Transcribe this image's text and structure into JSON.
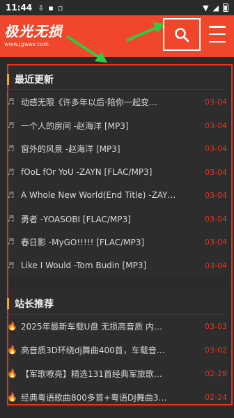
{
  "status": {
    "time": "11:44"
  },
  "header": {
    "logo_text": "极光无损",
    "logo_sub": "www.jgwav.com",
    "accent": "#f0472c"
  },
  "sections": {
    "recent": {
      "title": "最近更新",
      "items": [
        {
          "title": "动感无限《许多年以后·陪你一起变…",
          "date": "03-04"
        },
        {
          "title": "一个人的房间 -赵海洋 [MP3]",
          "date": "03-04"
        },
        {
          "title": "窗外的风景 -赵海洋 [MP3]",
          "date": "03-04"
        },
        {
          "title": "fOoL fOr YoU -ZAYN [FLAC/MP3]",
          "date": "03-04"
        },
        {
          "title": "A Whole New World(End Title) -ZAY…",
          "date": "03-04"
        },
        {
          "title": "勇者 -YOASOBI [FLAC/MP3]",
          "date": "03-04"
        },
        {
          "title": "春日影 -MyGO!!!!! [FLAC/MP3]",
          "date": "03-04"
        },
        {
          "title": "Like I Would -Tom Budin [MP3]",
          "date": "03-04"
        }
      ]
    },
    "recommend": {
      "title": "站长推荐",
      "items": [
        {
          "title": "2025年最新车载U盘 无损高音质 内…",
          "date": "03-03"
        },
        {
          "title": "高音质3D环绕dj舞曲400首，车载音…",
          "date": "03-02"
        },
        {
          "title": "【军歌嘹亮】精选131首经典军旅歌…",
          "date": "02-28"
        },
        {
          "title": "经典粤语歌曲800多首+粤语DJ舞曲3…",
          "date": "02-24"
        }
      ]
    }
  },
  "icons": {
    "search": "search-icon",
    "menu": "menu-icon",
    "music_note": "music-note-icon",
    "fire": "fire-icon"
  }
}
